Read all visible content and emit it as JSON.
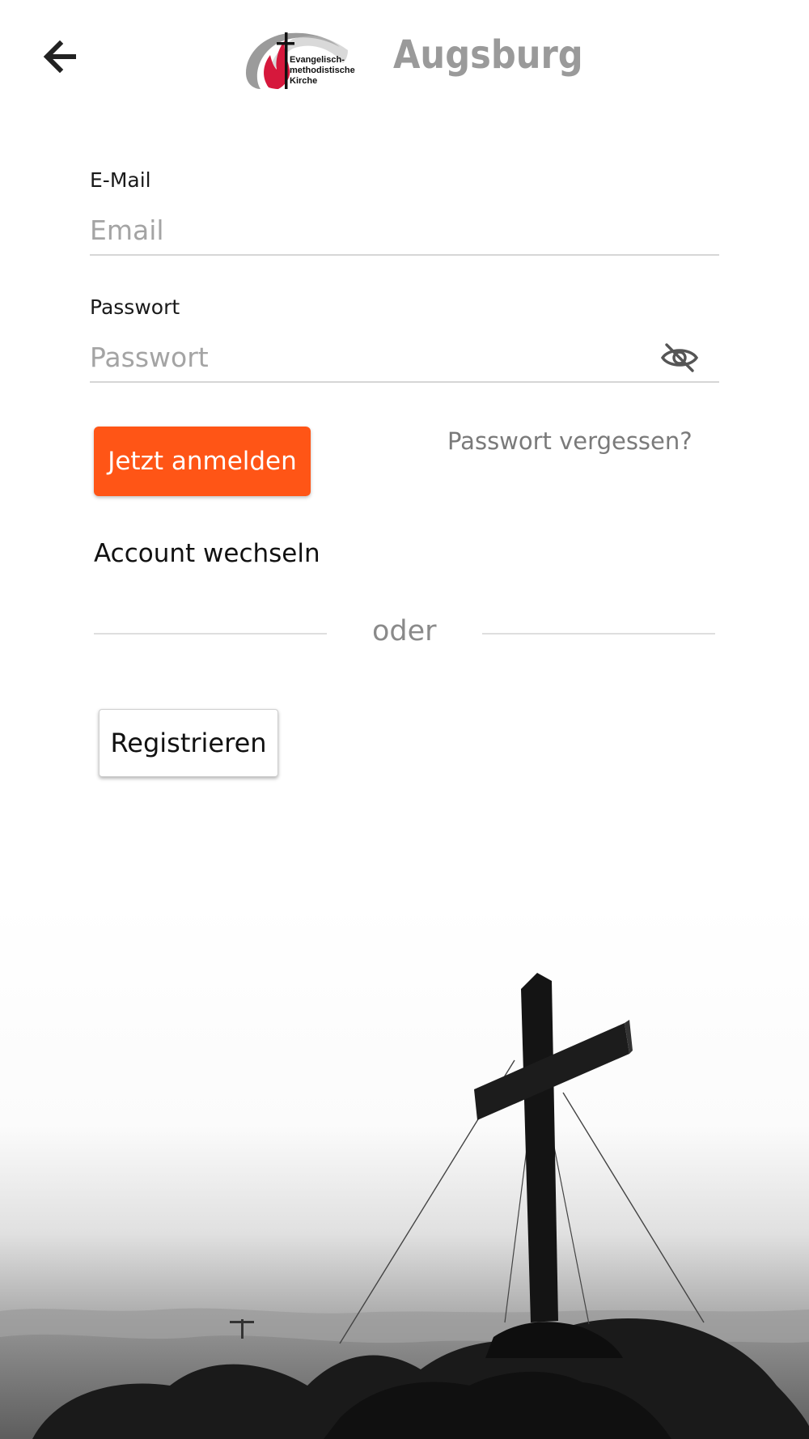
{
  "header": {
    "back_icon": "arrow-left-icon",
    "logo_text": "Evangelisch-\nmethodistische\nKirche",
    "location": "Augsburg"
  },
  "form": {
    "email_label": "E-Mail",
    "email_placeholder": "Email",
    "email_value": "",
    "password_label": "Passwort",
    "password_placeholder": "Passwort",
    "password_value": "",
    "password_visibility_icon": "eye-off-icon",
    "login_label": "Jetzt anmelden",
    "forgot_label": "Passwort vergessen?",
    "switch_account_label": "Account wechseln",
    "divider_label": "oder",
    "register_label": "Registrieren"
  },
  "colors": {
    "accent": "#ff5516",
    "title_gray": "#9a9a9a",
    "logo_red": "#d6183c",
    "logo_gray": "#9b9b9b"
  },
  "background": {
    "image": "summit-cross-photo"
  }
}
